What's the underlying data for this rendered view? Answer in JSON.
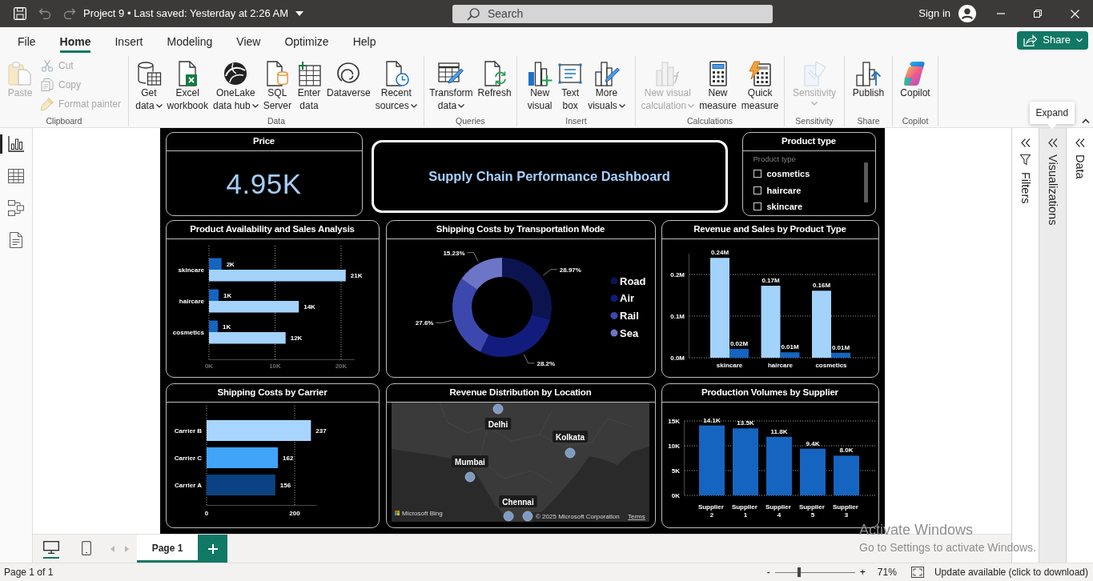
{
  "title_bar": {
    "quick_access": [
      {
        "disabled": false
      },
      {
        "disabled": true
      },
      {
        "disabled": true
      }
    ],
    "file_title": "Project 9 • Last saved: Yesterday at 2:26 AM",
    "search": {
      "placeholder": "Search"
    },
    "sign_in": "Sign in"
  },
  "ribbon": {
    "tabs": [
      {
        "label": "File",
        "selected": false
      },
      {
        "label": "Home",
        "selected": true
      },
      {
        "label": "Insert",
        "selected": false
      },
      {
        "label": "Modeling",
        "selected": false
      },
      {
        "label": "View",
        "selected": false
      },
      {
        "label": "Optimize",
        "selected": false
      },
      {
        "label": "Help",
        "selected": false
      }
    ],
    "share_button": "Share",
    "groups": [
      {
        "label": "Clipboard",
        "buttons": [
          {
            "label": "Paste",
            "kind": "large",
            "disabled": true,
            "dropdown": false
          },
          {
            "label": "Cut",
            "kind": "small",
            "disabled": true,
            "dropdown": false
          },
          {
            "label": "Copy",
            "kind": "small",
            "disabled": true,
            "dropdown": false
          },
          {
            "label": "Format painter",
            "kind": "small",
            "disabled": true,
            "dropdown": false
          }
        ]
      },
      {
        "label": "Data",
        "buttons": [
          {
            "label": "Get\ndata",
            "kind": "large",
            "disabled": false,
            "dropdown": true
          },
          {
            "label": "Excel\nworkbook",
            "kind": "large",
            "disabled": false,
            "dropdown": false
          },
          {
            "label": "OneLake\ndata hub",
            "kind": "large",
            "disabled": false,
            "dropdown": true
          },
          {
            "label": "SQL\nServer",
            "kind": "large",
            "disabled": false,
            "dropdown": false
          },
          {
            "label": "Enter\ndata",
            "kind": "large",
            "disabled": false,
            "dropdown": false
          },
          {
            "label": "Dataverse",
            "kind": "large",
            "disabled": false,
            "dropdown": false
          },
          {
            "label": "Recent\nsources",
            "kind": "large",
            "disabled": false,
            "dropdown": true
          }
        ]
      },
      {
        "label": "Queries",
        "buttons": [
          {
            "label": "Transform\ndata",
            "kind": "large",
            "disabled": false,
            "dropdown": true
          },
          {
            "label": "Refresh",
            "kind": "large",
            "disabled": false,
            "dropdown": false
          }
        ]
      },
      {
        "label": "Insert",
        "buttons": [
          {
            "label": "New\nvisual",
            "kind": "large",
            "disabled": false,
            "dropdown": false
          },
          {
            "label": "Text\nbox",
            "kind": "large",
            "disabled": false,
            "dropdown": false
          },
          {
            "label": "More\nvisuals",
            "kind": "large",
            "disabled": false,
            "dropdown": true
          }
        ]
      },
      {
        "label": "Calculations",
        "buttons": [
          {
            "label": "New visual\ncalculation",
            "kind": "large",
            "disabled": true,
            "dropdown": true
          },
          {
            "label": "New\nmeasure",
            "kind": "large",
            "disabled": false,
            "dropdown": false
          },
          {
            "label": "Quick\nmeasure",
            "kind": "large",
            "disabled": false,
            "dropdown": false
          }
        ]
      },
      {
        "label": "Sensitivity",
        "buttons": [
          {
            "label": "Sensitivity",
            "kind": "large",
            "disabled": true,
            "dropdown": true
          }
        ]
      },
      {
        "label": "Share",
        "buttons": [
          {
            "label": "Publish",
            "kind": "large",
            "disabled": false,
            "dropdown": false
          }
        ]
      },
      {
        "label": "Copilot",
        "buttons": [
          {
            "label": "Copilot",
            "kind": "large",
            "disabled": false,
            "dropdown": false
          }
        ]
      }
    ]
  },
  "view_switcher": [
    {
      "selected": true
    },
    {
      "selected": false
    },
    {
      "selected": false
    },
    {
      "selected": false
    }
  ],
  "report": {
    "price_card": {
      "title": "Price",
      "value": "4.95K"
    },
    "title_card": {
      "text": "Supply Chain Performance Dashboard"
    },
    "slicer": {
      "title": "Product type",
      "header": "Product type",
      "items": [
        {
          "label": "cosmetics",
          "checked": false
        },
        {
          "label": "haircare",
          "checked": false
        },
        {
          "label": "skincare",
          "checked": false
        }
      ]
    },
    "visuals": [
      {
        "title": "Product Availability and Sales Analysis",
        "kind": "chart",
        "chart_data": {
          "type": "bar",
          "orientation": "horizontal",
          "categories": [
            "skincare",
            "haircare",
            "cosmetics"
          ],
          "series": [
            {
              "color": "#1565c0",
              "values": [
                1900,
                1450,
                1330
              ],
              "value_labels": [
                "2K",
                "1K",
                "1K"
              ]
            },
            {
              "color": "#a3d2fb",
              "values": [
                20700,
                13600,
                11600
              ],
              "value_labels": [
                "21K",
                "14K",
                "12K"
              ]
            }
          ],
          "xlim": [
            0,
            22000
          ],
          "xticks": [
            {
              "value": 0,
              "label": "0K"
            },
            {
              "value": 10000,
              "label": "10K"
            },
            {
              "value": 20000,
              "label": "20K"
            }
          ],
          "grid": true
        }
      },
      {
        "title": "Shipping Costs by Transportation Mode",
        "kind": "chart",
        "chart_data": {
          "type": "donut",
          "categories": [
            "Road",
            "Air",
            "Rail",
            "Sea"
          ],
          "values": [
            28.97,
            28.2,
            27.6,
            15.23
          ],
          "colors": [
            "#0c1450",
            "#121c7c",
            "#3c48ae",
            "#6d75c7"
          ],
          "value_labels": [
            "28.97%",
            "28.2%",
            "27.6%",
            "15.23%"
          ],
          "legend": "right"
        }
      },
      {
        "title": "Revenue and Sales by Product Type",
        "kind": "chart",
        "chart_data": {
          "type": "bar",
          "orientation": "vertical",
          "categories": [
            "skincare",
            "haircare",
            "cosmetics"
          ],
          "series": [
            {
              "color": "#a3d2fb",
              "values": [
                240000,
                173000,
                161000
              ],
              "value_labels": [
                "0.24M",
                "0.17M",
                "0.16M"
              ]
            },
            {
              "color": "#1565c0",
              "values": [
                21000,
                13000,
                12000
              ],
              "value_labels": [
                "0.02M",
                "0.01M",
                "0.01M"
              ]
            }
          ],
          "ylim": [
            0,
            250000
          ],
          "yticks": [
            {
              "value": 0,
              "label": "0.0M"
            },
            {
              "value": 100000,
              "label": "0.1M"
            },
            {
              "value": 200000,
              "label": "0.2M"
            }
          ],
          "grid": true
        }
      },
      {
        "title": "Shipping Costs by Carrier",
        "kind": "chart",
        "chart_data": {
          "type": "bar",
          "orientation": "horizontal",
          "categories": [
            "Carrier B",
            "Carrier C",
            "Carrier A"
          ],
          "series": [
            {
              "values": [
                237,
                162,
                156
              ],
              "value_labels": [
                "237",
                "162",
                "156"
              ]
            }
          ],
          "colors": [
            "#a8d5ff",
            "#40a4f8",
            "#0b4283"
          ],
          "xlim": [
            0,
            250
          ],
          "xticks": [
            0,
            200
          ],
          "grid": true
        }
      },
      {
        "title": "Revenue Distribution by Location",
        "kind": "map",
        "locations": [
          {
            "label": "Delhi"
          },
          {
            "label": "Kolkata"
          },
          {
            "label": "Mumbai"
          },
          {
            "label": "Chennai"
          }
        ],
        "attribution": {
          "provider": "Microsoft Bing",
          "copyright": "© 2025 Microsoft Corporation",
          "terms": "Terms"
        }
      },
      {
        "title": "Production Volumes by Supplier",
        "kind": "chart",
        "chart_data": {
          "type": "bar",
          "orientation": "vertical",
          "categories": [
            "Supplier 2",
            "Supplier 1",
            "Supplier 4",
            "Supplier 5",
            "Supplier 3"
          ],
          "series": [
            {
              "color": "#1565c0",
              "values": [
                14100,
                13500,
                11800,
                9400,
                8000
              ],
              "value_labels": [
                "14.1K",
                "13.5K",
                "11.8K",
                "9.4K",
                "8.0K"
              ]
            }
          ],
          "ylim": [
            0,
            15000
          ],
          "yticks": [
            {
              "value": 0,
              "label": "0K"
            },
            {
              "value": 5000,
              "label": "5K"
            },
            {
              "value": 10000,
              "label": "10K"
            },
            {
              "value": 15000,
              "label": "15K"
            }
          ],
          "grid": true
        }
      }
    ]
  },
  "panes": [
    {
      "label": "Filters",
      "hovered": false
    },
    {
      "label": "Visualizations",
      "hovered": true,
      "tooltip": "Expand"
    },
    {
      "label": "Data",
      "hovered": false
    }
  ],
  "page_bar": {
    "layouts": [
      {
        "selected": true
      },
      {
        "selected": false
      }
    ],
    "page_arrows": [
      {
        "disabled": true
      },
      {
        "disabled": true
      }
    ],
    "pages": [
      {
        "label": "Page 1",
        "selected": true
      }
    ]
  },
  "status_bar": {
    "page_info": "Page 1 of 1",
    "zoom": {
      "out": "-",
      "in": "+",
      "level": 0.3,
      "reading": "71%"
    },
    "update": "Update available (click to download)"
  },
  "system_notice": {
    "title": "Activate Windows",
    "text": "Go to Settings to activate Windows."
  }
}
